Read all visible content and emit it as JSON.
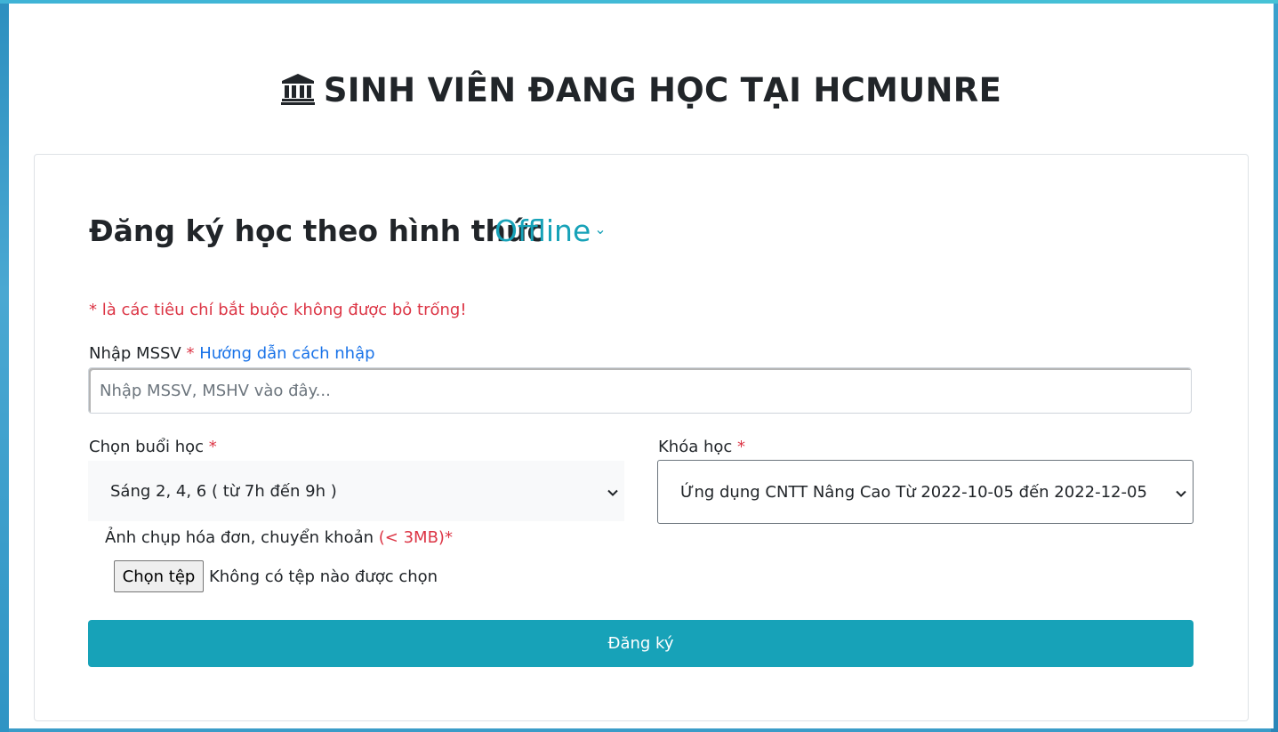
{
  "header": {
    "title": "SINH VIÊN ĐANG HỌC TẠI HCMUNRE",
    "icon": "bank-icon"
  },
  "form": {
    "heading": "Đăng ký học theo hình thức",
    "mode": "Offline",
    "required_note": "* là các tiêu chí bắt buộc không được bỏ trống!",
    "mssv": {
      "label": "Nhập MSSV",
      "required_mark": "*",
      "help_link": "Hướng dẫn cách nhập",
      "placeholder": "Nhập MSSV, MSHV vào đây...",
      "value": ""
    },
    "session": {
      "label": "Chọn buổi học",
      "required_mark": "*",
      "selected": "Sáng 2, 4, 6 ( từ 7h đến 9h )"
    },
    "course": {
      "label": "Khóa học",
      "required_mark": "*",
      "selected": "Ứng dụng CNTT Nâng Cao Từ 2022-10-05 đến 2022-12-05"
    },
    "file": {
      "label": "Ảnh chụp hóa đơn, chuyển khoản",
      "size_limit": "(< 3MB)*",
      "button": "Chọn tệp",
      "status": "Không có tệp nào được chọn"
    },
    "submit_label": "Đăng ký"
  },
  "colors": {
    "accent": "#17a2b8",
    "required": "#dc3545",
    "link": "#1a73e8",
    "background": "#3a9cc8"
  }
}
